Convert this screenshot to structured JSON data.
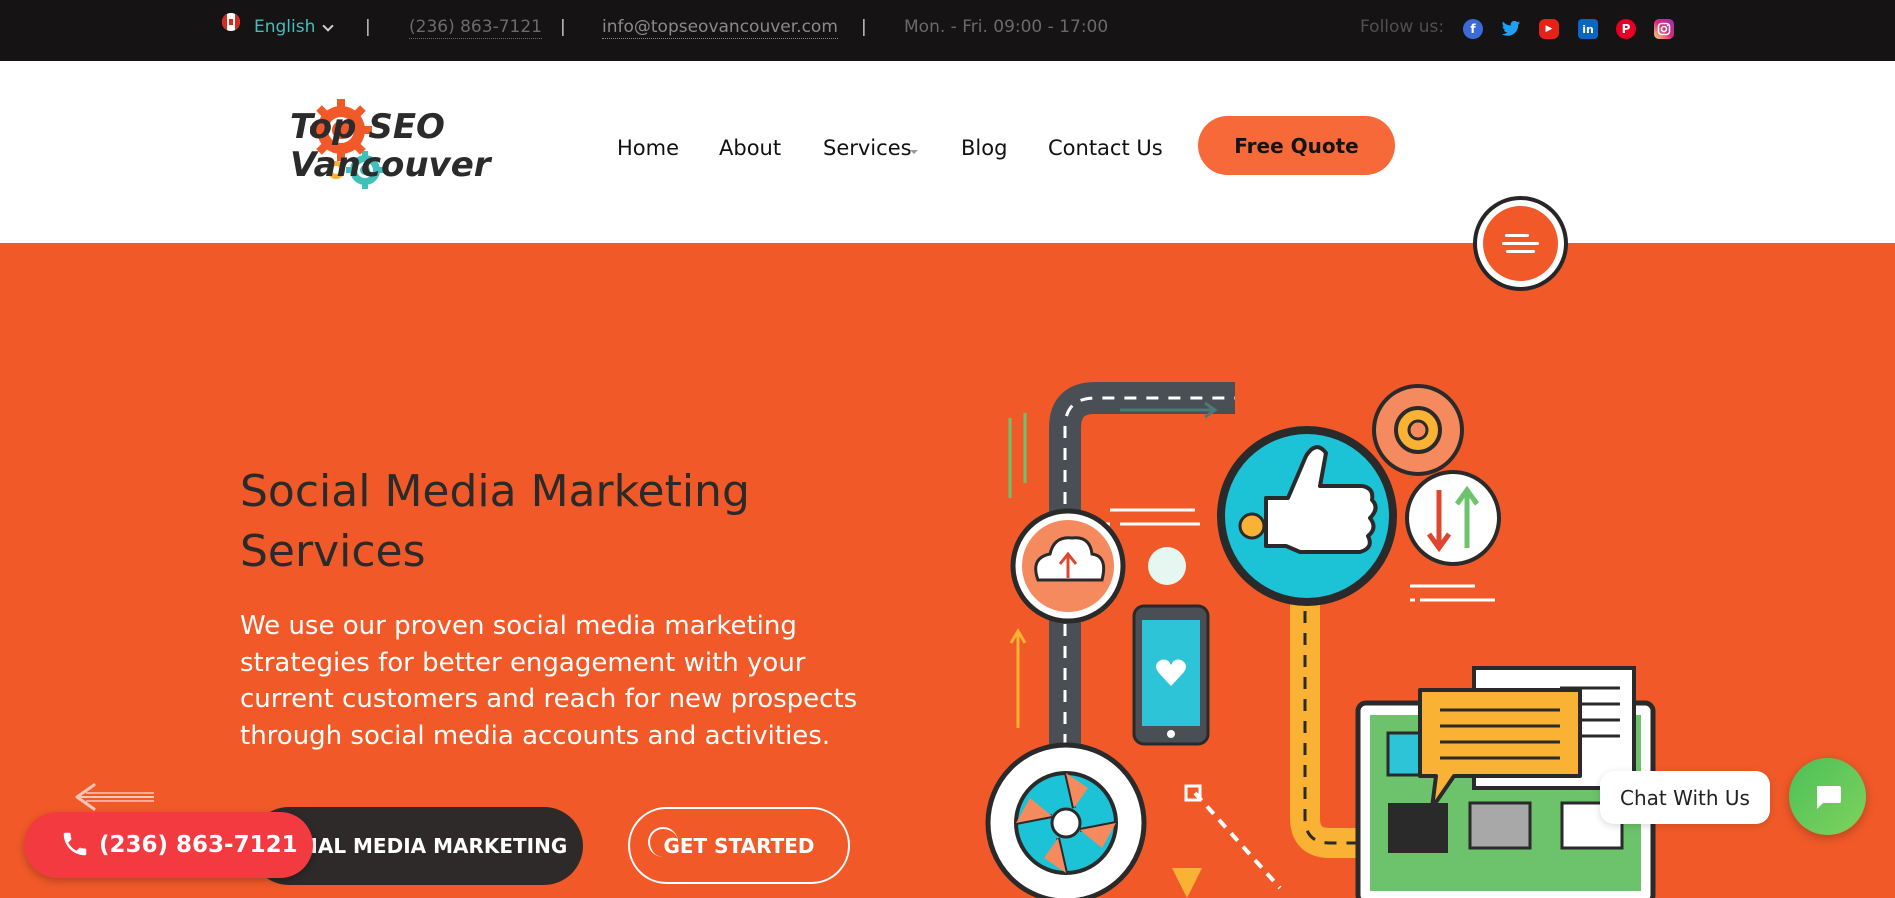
{
  "topbar": {
    "language": "English",
    "separator": "|",
    "phone": "(236) 863-7121",
    "email": "info@topseovancouver.com",
    "hours": "Mon. - Fri. 09:00 - 17:00",
    "follow_label": "Follow us:",
    "socials": [
      "facebook-icon",
      "twitter-icon",
      "youtube-icon",
      "linkedin-icon",
      "pinterest-icon",
      "instagram-icon"
    ]
  },
  "header": {
    "logo_line1": "Top SEO",
    "logo_line2": "Vancouver",
    "nav": [
      "Home",
      "About",
      "Services",
      "Blog",
      "Contact Us"
    ],
    "cta": "Free Quote"
  },
  "hero": {
    "title": "Social Media Marketing Services",
    "description": "We use our proven social media marketing strategies for better engagement with your current customers and reach for new prospects through social media accounts and activities.",
    "primary_button": "CIAL MEDIA MARKETING",
    "secondary_button": "GET STARTED"
  },
  "floating": {
    "call_label": "(236) 863-7121",
    "chat_label": "Chat With Us"
  },
  "colors": {
    "topbar_bg": "#161314",
    "accent": "#f15a28",
    "cta": "#f8693a",
    "call": "#f33a40",
    "chat": "#4cbf5a",
    "lang": "#3fc0ba"
  }
}
